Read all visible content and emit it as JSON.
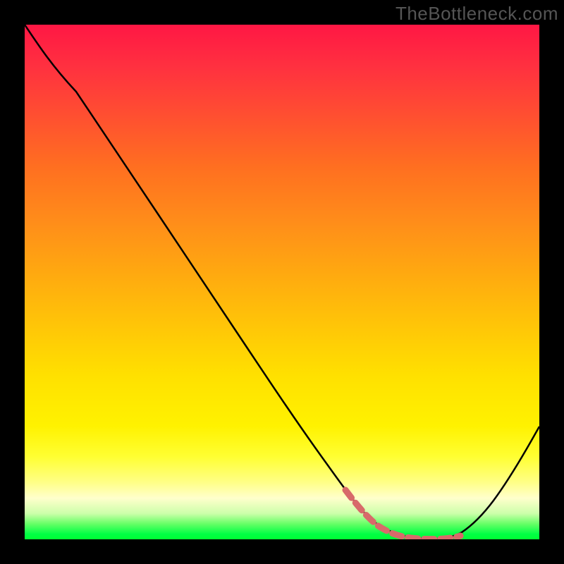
{
  "watermark": "TheBottleneck.com",
  "chart_data": {
    "type": "line",
    "title": "",
    "xlabel": "",
    "ylabel": "",
    "xlim": [
      0,
      100
    ],
    "ylim": [
      0,
      100
    ],
    "series": [
      {
        "name": "curve",
        "color": "#000000",
        "x": [
          0,
          5,
          10,
          15,
          20,
          25,
          30,
          35,
          40,
          45,
          50,
          55,
          60,
          63,
          66,
          70,
          74,
          78,
          80,
          83,
          86,
          90,
          95,
          100
        ],
        "y": [
          100,
          95,
          89,
          82,
          75,
          68,
          61,
          54,
          47,
          40,
          33,
          26,
          19,
          14,
          10,
          6,
          3,
          1,
          0,
          0,
          1,
          4,
          12,
          25
        ]
      },
      {
        "name": "highlight",
        "color": "#d86a6a",
        "style": "dashed-thick",
        "x": [
          63,
          66,
          70,
          74,
          78,
          80,
          83
        ],
        "y": [
          14,
          10,
          6,
          3,
          1,
          0,
          0
        ]
      }
    ],
    "gradient": {
      "direction": "vertical",
      "stops": [
        {
          "pos": 0,
          "color": "#ff1744"
        },
        {
          "pos": 50,
          "color": "#ffc408"
        },
        {
          "pos": 85,
          "color": "#ffff66"
        },
        {
          "pos": 100,
          "color": "#00ff33"
        }
      ]
    },
    "minimum_region": {
      "x_start": 63,
      "x_end": 83
    }
  }
}
